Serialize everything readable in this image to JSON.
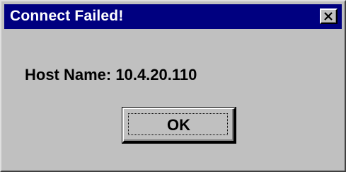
{
  "dialog": {
    "title": "Connect Failed!",
    "message": "Host Name: 10.4.20.110",
    "ok_label": "OK",
    "close_icon": "close-icon"
  },
  "colors": {
    "titlebar": "#000080",
    "title_text": "#ffffff",
    "face": "#c0c0c0"
  }
}
